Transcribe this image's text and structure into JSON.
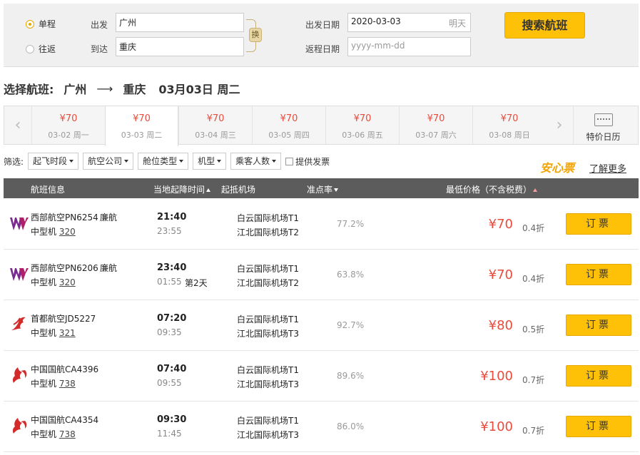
{
  "search": {
    "one_way": "单程",
    "round_trip": "往返",
    "from_label": "出发",
    "to_label": "到达",
    "from_value": "广州",
    "to_value": "重庆",
    "swap_label": "换",
    "depart_date_label": "出发日期",
    "depart_date_value": "2020-03-03",
    "depart_date_hint": "明天",
    "return_date_label": "返程日期",
    "return_date_placeholder": "yyyy-mm-dd",
    "button": "搜索航班",
    "accent_color": "#ffc107"
  },
  "route": {
    "prefix": "选择航班:",
    "from": "广州",
    "arrow": "⟶",
    "to": "重庆",
    "date": "03月03日 周二"
  },
  "dates": [
    {
      "price": "¥70",
      "date": "03-02 周一"
    },
    {
      "price": "¥70",
      "date": "03-03 周二"
    },
    {
      "price": "¥70",
      "date": "03-04 周三"
    },
    {
      "price": "¥70",
      "date": "03-05 周四"
    },
    {
      "price": "¥70",
      "date": "03-06 周五"
    },
    {
      "price": "¥70",
      "date": "03-07 周六"
    },
    {
      "price": "¥70",
      "date": "03-08 周日"
    }
  ],
  "calendar_label": "特价日历",
  "filters": {
    "label": "筛选:",
    "items": [
      "起飞时段",
      "航空公司",
      "舱位类型",
      "机型",
      "乘客人数"
    ],
    "invoice": "提供发票"
  },
  "promo": {
    "title": "安心票",
    "link": "了解更多"
  },
  "table_header": {
    "flight": "航班信息",
    "time": "当地起降时间",
    "airport": "起抵机场",
    "ontime": "准点率",
    "price": "最低价格（不含税费）"
  },
  "flights": [
    {
      "airline": "西部航空PN6254",
      "tag": "廉航",
      "aircraft": "中型机",
      "model": "320",
      "dep": "21:40",
      "arr": "23:55",
      "next": "",
      "dep_ap": "白云国际机场T1",
      "arr_ap": "江北国际机场T2",
      "rate": "77.2%",
      "price": "¥70",
      "discount": "0.4折",
      "book": "订票",
      "logo": "west-air-logo"
    },
    {
      "airline": "西部航空PN6206",
      "tag": "廉航",
      "aircraft": "中型机",
      "model": "320",
      "dep": "23:40",
      "arr": "01:55",
      "next": "第2天",
      "dep_ap": "白云国际机场T1",
      "arr_ap": "江北国际机场T2",
      "rate": "63.8%",
      "price": "¥70",
      "discount": "0.4折",
      "book": "订票",
      "logo": "west-air-logo"
    },
    {
      "airline": "首都航空JD5227",
      "tag": "",
      "aircraft": "中型机",
      "model": "321",
      "dep": "07:20",
      "arr": "09:35",
      "next": "",
      "dep_ap": "白云国际机场T1",
      "arr_ap": "江北国际机场T3",
      "rate": "92.7%",
      "price": "¥80",
      "discount": "0.5折",
      "book": "订票",
      "logo": "capital-air-logo"
    },
    {
      "airline": "中国国航CA4396",
      "tag": "",
      "aircraft": "中型机",
      "model": "738",
      "dep": "07:40",
      "arr": "09:55",
      "next": "",
      "dep_ap": "白云国际机场T1",
      "arr_ap": "江北国际机场T3",
      "rate": "89.6%",
      "price": "¥100",
      "discount": "0.7折",
      "book": "订票",
      "logo": "air-china-logo"
    },
    {
      "airline": "中国国航CA4354",
      "tag": "",
      "aircraft": "中型机",
      "model": "738",
      "dep": "09:30",
      "arr": "11:45",
      "next": "",
      "dep_ap": "白云国际机场T1",
      "arr_ap": "江北国际机场T3",
      "rate": "86.0%",
      "price": "¥100",
      "discount": "0.7折",
      "book": "订票",
      "logo": "air-china-logo"
    }
  ]
}
